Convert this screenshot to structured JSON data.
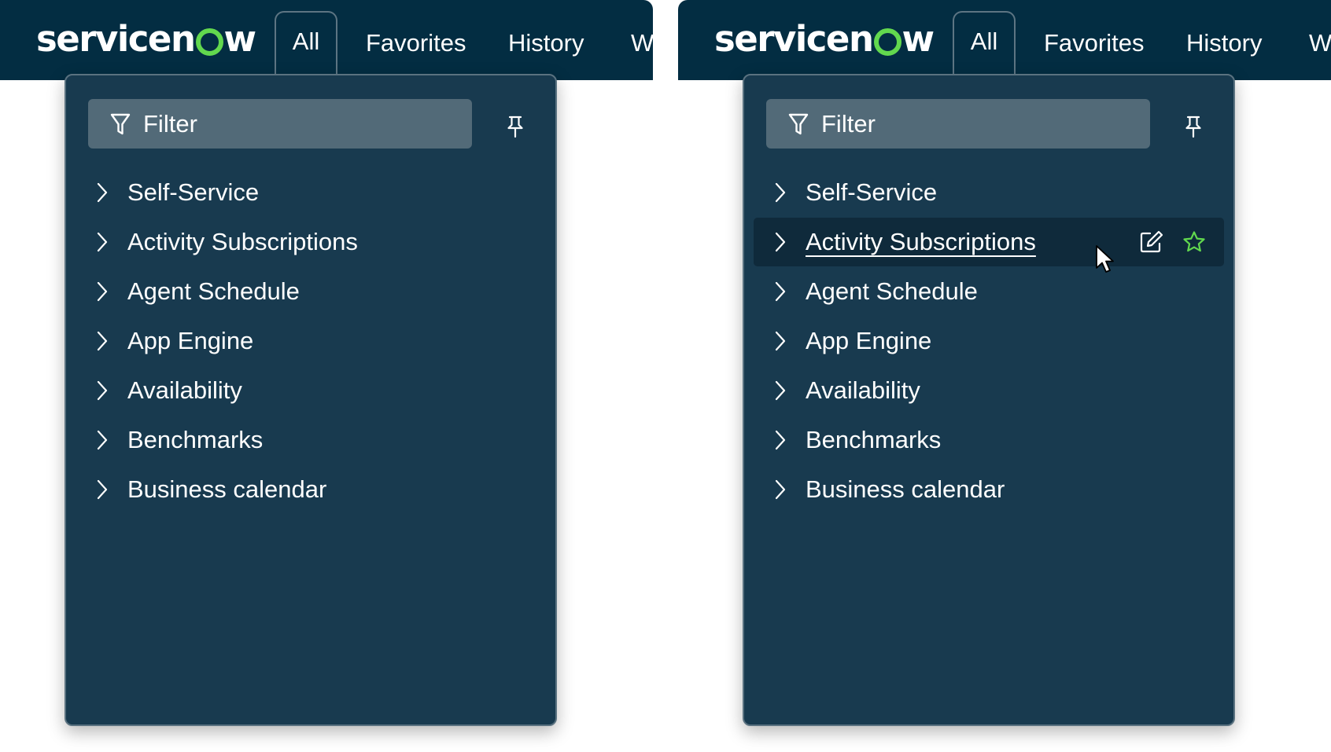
{
  "logo": {
    "text_before_o": "servicen",
    "text_after_o": "w",
    "accent_color": "#62d84e"
  },
  "nav": {
    "tabs": [
      {
        "label": "All",
        "active": true
      },
      {
        "label": "Favorites"
      },
      {
        "label": "History"
      },
      {
        "label": "W"
      }
    ]
  },
  "menu": {
    "filter_placeholder": "Filter",
    "items": [
      {
        "label": "Self-Service"
      },
      {
        "label": "Activity Subscriptions"
      },
      {
        "label": "Agent Schedule"
      },
      {
        "label": "App Engine"
      },
      {
        "label": "Availability"
      },
      {
        "label": "Benchmarks"
      },
      {
        "label": "Business calendar"
      }
    ]
  },
  "icons": {
    "filter": "filter-icon",
    "pin": "pin-icon",
    "chevron": "chevron-right-icon",
    "edit": "edit-icon",
    "favorite": "star-icon",
    "cursor": "mouse-pointer-icon"
  },
  "colors": {
    "header_bg": "#032d42",
    "menu_bg": "#183a4f",
    "hover_row_bg": "#0f2a3b",
    "filter_bg": "#526a78",
    "favorite_star": "#62d84e"
  },
  "panels": [
    {
      "state": "default"
    },
    {
      "state": "hover",
      "hovered_item": "Activity Subscriptions"
    }
  ]
}
